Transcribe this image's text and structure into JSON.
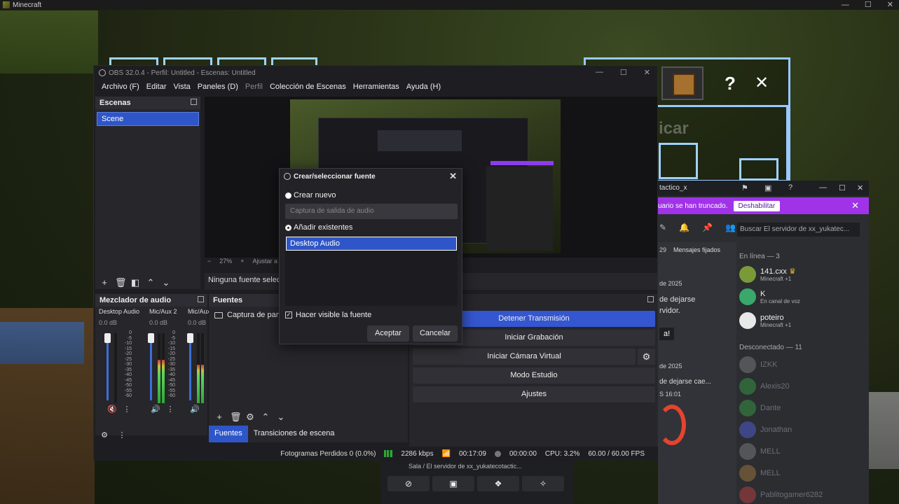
{
  "minecraft": {
    "window_title": "Minecraft",
    "background_word": "icar"
  },
  "obs": {
    "title": "OBS 32.0.4 - Perfil: Untitled - Escenas: Untitled",
    "menu": [
      "Archivo (F)",
      "Editar",
      "Vista",
      "Paneles (D)",
      "Perfil",
      "Colección de Escenas",
      "Herramientas",
      "Ayuda (H)"
    ],
    "scenes": {
      "header": "Escenas",
      "items": [
        "Scene"
      ]
    },
    "preview": {
      "zoom": "27%",
      "fit": "Ajustar a"
    },
    "source_bar": "Ninguna fuente selecci",
    "mixer": {
      "header": "Mezclador de audio",
      "channels": [
        {
          "name": "Desktop Audio",
          "db": "0.0 dB",
          "level": 0.0
        },
        {
          "name": "Mic/Aux 2",
          "db": "0.0 dB",
          "level": 0.62
        },
        {
          "name": "Mic/Aux",
          "db": "0.0 dB",
          "level": 0.55
        }
      ],
      "scale": [
        "0",
        "-5",
        "-10",
        "-15",
        "-20",
        "-25",
        "-30",
        "-35",
        "-40",
        "-45",
        "-50",
        "-55",
        "-60"
      ]
    },
    "sources": {
      "header": "Fuentes",
      "items": [
        "Captura de panta"
      ]
    },
    "controls": {
      "buttons": [
        "Detener Transmisión",
        "Iniciar Grabación",
        "Iniciar Cámara Virtual",
        "Modo Estudio",
        "Ajustes"
      ]
    },
    "bottom_tabs": [
      "Fuentes",
      "Transiciones de escena"
    ],
    "status": {
      "dropped_frames": "Fotogramas Perdidos 0 (0.0%)",
      "bitrate": "2286 kbps",
      "stream_time": "00:17:09",
      "record_time": "00:00:00",
      "cpu": "CPU: 3.2%",
      "fps": "60.00 / 60.00 FPS"
    }
  },
  "dialog": {
    "title": "Crear/seleccionar fuente",
    "create_new_label": "Crear nuevo",
    "create_new_placeholder": "Captura de salida de audio",
    "add_existing_label": "Añadir existentes",
    "existing_items": [
      "Desktop Audio"
    ],
    "visible_label": "Hacer visible la fuente",
    "ok": "Aceptar",
    "cancel": "Cancelar"
  },
  "discord": {
    "server_title": "tactico_x",
    "banner_text": "uario se han truncado.",
    "banner_button": "Deshabilitar",
    "search_placeholder": "Buscar El servidor de xx_yukatec...",
    "pinned": "Mensajes fijados",
    "chat": {
      "date1": "de 2025",
      "msg1": "de dejarse",
      "msg2": "rvidor.",
      "bang": "a!",
      "date2": "de 2025",
      "msg3": "de dejarse cae...",
      "time": "S 16:01",
      "count": "29"
    },
    "online_header": "En línea — 3",
    "online": [
      {
        "name": "141.cxx",
        "status": "Minecraft +1",
        "crown": "♛",
        "color": "#7a9a3a"
      },
      {
        "name": "K",
        "status": "En canal de voz",
        "color": "#3aa86b"
      },
      {
        "name": "poteiro",
        "status": "Minecraft +1",
        "color": "#e8e8e8"
      }
    ],
    "offline_header": "Desconectado — 11",
    "offline": [
      {
        "name": "IZKK",
        "color": "#888888"
      },
      {
        "name": "Alexis20",
        "color": "#3aa84a"
      },
      {
        "name": "Dante",
        "color": "#3aa84a"
      },
      {
        "name": "Jonathan",
        "color": "#5865f2"
      },
      {
        "name": "MELL",
        "color": "#888888"
      },
      {
        "name": "MELL",
        "color": "#b08040"
      },
      {
        "name": "Pablitogamer6282",
        "color": "#c44"
      }
    ],
    "voice_panel": "Sala / El servidor de xx_yukatecotactic..."
  }
}
